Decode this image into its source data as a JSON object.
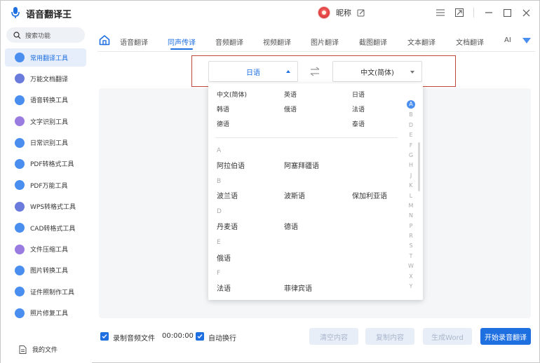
{
  "app": {
    "title": "语音翻译王"
  },
  "user": {
    "nickname": "昵称"
  },
  "search": {
    "placeholder": "搜索功能"
  },
  "sidebar": {
    "items": [
      {
        "label": "常用翻译工具",
        "icon": "translate-icon",
        "color": "#4a8ef0",
        "active": true
      },
      {
        "label": "万能文档翻译",
        "icon": "document-icon",
        "color": "#6b7bdc"
      },
      {
        "label": "语音转换工具",
        "icon": "voice-icon",
        "color": "#4a8ef0"
      },
      {
        "label": "文字识别工具",
        "icon": "ocr-icon",
        "color": "#9a7be0"
      },
      {
        "label": "日常识别工具",
        "icon": "scan-icon",
        "color": "#4a8ef0"
      },
      {
        "label": "PDF转格式工具",
        "icon": "pdf-icon",
        "color": "#4a8ef0"
      },
      {
        "label": "PDF万能工具",
        "icon": "pdf-tools-icon",
        "color": "#4a8ef0"
      },
      {
        "label": "WPS转格式工具",
        "icon": "wps-icon",
        "color": "#6b7bdc"
      },
      {
        "label": "CAD转格式工具",
        "icon": "cad-icon",
        "color": "#4a8ef0"
      },
      {
        "label": "文件压缩工具",
        "icon": "compress-icon",
        "color": "#9a7be0"
      },
      {
        "label": "图片转换工具",
        "icon": "image-icon",
        "color": "#4a8ef0"
      },
      {
        "label": "证件照制作工具",
        "icon": "id-photo-icon",
        "color": "#4a8ef0"
      },
      {
        "label": "照片修复工具",
        "icon": "photo-repair-icon",
        "color": "#4a8ef0"
      }
    ],
    "my_files": "我的文件"
  },
  "tabs": [
    {
      "label": "语音翻译"
    },
    {
      "label": "同声传译",
      "active": true
    },
    {
      "label": "音频翻译"
    },
    {
      "label": "视频翻译"
    },
    {
      "label": "图片翻译"
    },
    {
      "label": "截图翻译"
    },
    {
      "label": "文本翻译"
    },
    {
      "label": "文档翻译"
    },
    {
      "label": "AI"
    }
  ],
  "language": {
    "source": "日语",
    "target": "中文(简体)"
  },
  "dropdown": {
    "common": [
      [
        "中文(简体)",
        "英语",
        "日语"
      ],
      [
        "韩语",
        "俄语",
        "法语"
      ],
      [
        "德语",
        "",
        "泰语"
      ]
    ],
    "groups": [
      {
        "letter": "A",
        "langs": [
          "阿拉伯语",
          "阿塞拜疆语"
        ]
      },
      {
        "letter": "B",
        "langs": [
          "波兰语",
          "波斯语",
          "保加利亚语"
        ]
      },
      {
        "letter": "D",
        "langs": [
          "丹麦语",
          "德语"
        ]
      },
      {
        "letter": "E",
        "langs": [
          "俄语"
        ]
      },
      {
        "letter": "F",
        "langs": [
          "法语",
          "菲律宾语"
        ]
      }
    ],
    "alphabet": [
      "A",
      "B",
      "D",
      "E",
      "F",
      "G",
      "H",
      "J",
      "K",
      "L",
      "M",
      "N",
      "P",
      "R",
      "S",
      "T",
      "W",
      "X",
      "Y"
    ],
    "alphabet_selected": "A"
  },
  "bottom": {
    "record_audio": "录制音频文件",
    "timer": "00:00:00",
    "auto_wrap": "自动换行",
    "clear": "清空内容",
    "copy": "复制内容",
    "generate_word": "生成Word",
    "start": "开始录音翻译"
  },
  "colors": {
    "accent": "#1e6fe0",
    "highlight_frame": "#c0483a"
  }
}
